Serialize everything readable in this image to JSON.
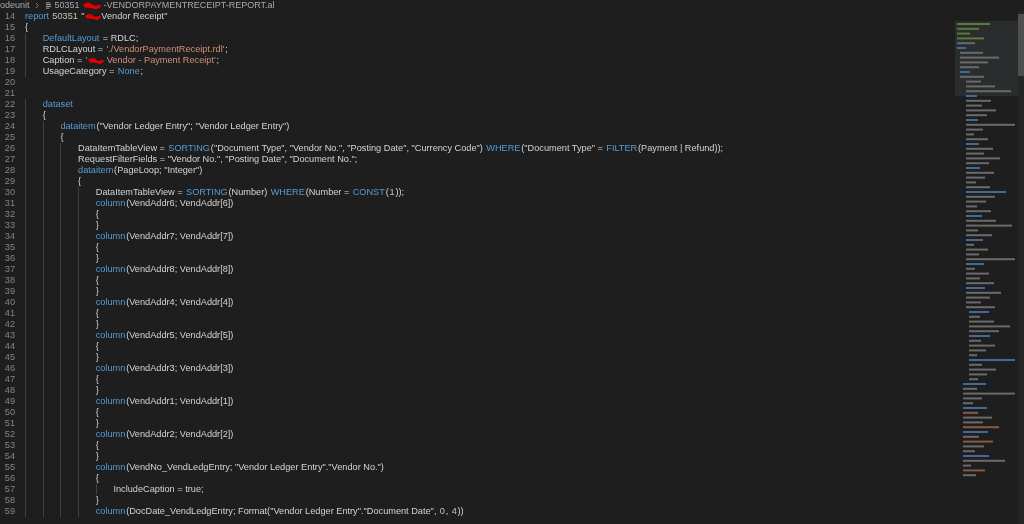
{
  "breadcrumb": {
    "folder": "odeunit",
    "file_prefix": "50351",
    "file_suffix": "-VENDORPAYMENTRECEIPT-REPORT.al"
  },
  "editor": {
    "lines": [
      {
        "number": "14",
        "tokens": [
          {
            "kind": "kw",
            "text": "report"
          },
          {
            "kind": "num",
            "text": " 50351"
          },
          {
            "kind": "plain",
            "text": " \""
          },
          {
            "kind": "redaction"
          },
          {
            "kind": "plain",
            "text": "Vendor Receipt\""
          }
        ]
      },
      {
        "number": "15",
        "tokens": [
          {
            "kind": "plain",
            "text": "{"
          }
        ]
      },
      {
        "number": "16",
        "tokens": [
          {
            "kind": "kw",
            "text": "    DefaultLayout"
          },
          {
            "kind": "plain",
            "text": " = RDLC;"
          }
        ]
      },
      {
        "number": "17",
        "tokens": [
          {
            "kind": "plain",
            "text": "    RDLCLayout = "
          },
          {
            "kind": "str",
            "text": "'./VendorPaymentReceipt.rdl'"
          },
          {
            "kind": "plain",
            "text": ";"
          }
        ]
      },
      {
        "number": "18",
        "tokens": [
          {
            "kind": "plain",
            "text": "    Caption = "
          },
          {
            "kind": "str",
            "text": "'"
          },
          {
            "kind": "redaction"
          },
          {
            "kind": "str",
            "text": " Vendor - Payment Receipt'"
          },
          {
            "kind": "plain",
            "text": ";"
          }
        ]
      },
      {
        "number": "19",
        "tokens": [
          {
            "kind": "plain",
            "text": "    UsageCategory = "
          },
          {
            "kind": "kw",
            "text": "None"
          },
          {
            "kind": "plain",
            "text": ";"
          }
        ]
      },
      {
        "number": "20"
      },
      {
        "number": "21"
      },
      {
        "number": "22",
        "tokens": [
          {
            "kind": "kw",
            "text": "    dataset"
          }
        ]
      },
      {
        "number": "23",
        "tokens": [
          {
            "kind": "plain",
            "text": "    {"
          }
        ]
      },
      {
        "number": "24",
        "tokens": [
          {
            "kind": "kw",
            "text": "        dataitem"
          },
          {
            "kind": "plain",
            "text": "(\"Vendor Ledger Entry\"; \"Vendor Ledger Entry\")"
          }
        ]
      },
      {
        "number": "25",
        "tokens": [
          {
            "kind": "plain",
            "text": "        {"
          }
        ]
      },
      {
        "number": "26",
        "tokens": [
          {
            "kind": "plain",
            "text": "            DataItemTableView = "
          },
          {
            "kind": "kw",
            "text": "SORTING"
          },
          {
            "kind": "plain",
            "text": "(\"Document Type\", \"Vendor No.\", \"Posting Date\", \"Currency Code\") "
          },
          {
            "kind": "kw",
            "text": "WHERE"
          },
          {
            "kind": "plain",
            "text": "(\"Document Type\" = "
          },
          {
            "kind": "kw",
            "text": "FILTER"
          },
          {
            "kind": "plain",
            "text": "(Payment | Refund));"
          }
        ]
      },
      {
        "number": "27",
        "tokens": [
          {
            "kind": "plain",
            "text": "            RequestFilterFields = \"Vendor No.\", \"Posting Date\", \"Document No.\";"
          }
        ]
      },
      {
        "number": "28",
        "tokens": [
          {
            "kind": "kw",
            "text": "            dataitem"
          },
          {
            "kind": "plain",
            "text": "(PageLoop; \"Integer\")"
          }
        ]
      },
      {
        "number": "29",
        "tokens": [
          {
            "kind": "plain",
            "text": "            {"
          }
        ]
      },
      {
        "number": "30",
        "tokens": [
          {
            "kind": "plain",
            "text": "                DataItemTableView = "
          },
          {
            "kind": "kw",
            "text": "SORTING"
          },
          {
            "kind": "plain",
            "text": "(Number) "
          },
          {
            "kind": "kw",
            "text": "WHERE"
          },
          {
            "kind": "plain",
            "text": "(Number = "
          },
          {
            "kind": "kw",
            "text": "CONST"
          },
          {
            "kind": "plain",
            "text": "("
          },
          {
            "kind": "num",
            "text": "1"
          },
          {
            "kind": "plain",
            "text": "));"
          }
        ]
      },
      {
        "number": "31",
        "tokens": [
          {
            "kind": "kw",
            "text": "                column"
          },
          {
            "kind": "plain",
            "text": "(VendAddr6; VendAddr[6])"
          }
        ]
      },
      {
        "number": "32",
        "tokens": [
          {
            "kind": "plain",
            "text": "                {"
          }
        ]
      },
      {
        "number": "33",
        "tokens": [
          {
            "kind": "plain",
            "text": "                }"
          }
        ]
      },
      {
        "number": "34",
        "tokens": [
          {
            "kind": "kw",
            "text": "                column"
          },
          {
            "kind": "plain",
            "text": "(VendAddr7; VendAddr[7])"
          }
        ]
      },
      {
        "number": "35",
        "tokens": [
          {
            "kind": "plain",
            "text": "                {"
          }
        ]
      },
      {
        "number": "36",
        "tokens": [
          {
            "kind": "plain",
            "text": "                }"
          }
        ]
      },
      {
        "number": "37",
        "tokens": [
          {
            "kind": "kw",
            "text": "                column"
          },
          {
            "kind": "plain",
            "text": "(VendAddr8; VendAddr[8])"
          }
        ]
      },
      {
        "number": "38",
        "tokens": [
          {
            "kind": "plain",
            "text": "                {"
          }
        ]
      },
      {
        "number": "39",
        "tokens": [
          {
            "kind": "plain",
            "text": "                }"
          }
        ]
      },
      {
        "number": "40",
        "tokens": [
          {
            "kind": "kw",
            "text": "                column"
          },
          {
            "kind": "plain",
            "text": "(VendAddr4; VendAddr[4])"
          }
        ]
      },
      {
        "number": "41",
        "tokens": [
          {
            "kind": "plain",
            "text": "                {"
          }
        ]
      },
      {
        "number": "42",
        "tokens": [
          {
            "kind": "plain",
            "text": "                }"
          }
        ]
      },
      {
        "number": "43",
        "tokens": [
          {
            "kind": "kw",
            "text": "                column"
          },
          {
            "kind": "plain",
            "text": "(VendAddr5; VendAddr[5])"
          }
        ]
      },
      {
        "number": "44",
        "tokens": [
          {
            "kind": "plain",
            "text": "                {"
          }
        ]
      },
      {
        "number": "45",
        "tokens": [
          {
            "kind": "plain",
            "text": "                }"
          }
        ]
      },
      {
        "number": "46",
        "tokens": [
          {
            "kind": "kw",
            "text": "                column"
          },
          {
            "kind": "plain",
            "text": "(VendAddr3; VendAddr[3])"
          }
        ]
      },
      {
        "number": "47",
        "tokens": [
          {
            "kind": "plain",
            "text": "                {"
          }
        ]
      },
      {
        "number": "48",
        "tokens": [
          {
            "kind": "plain",
            "text": "                }"
          }
        ]
      },
      {
        "number": "49",
        "tokens": [
          {
            "kind": "kw",
            "text": "                column"
          },
          {
            "kind": "plain",
            "text": "(VendAddr1; VendAddr[1])"
          }
        ]
      },
      {
        "number": "50",
        "tokens": [
          {
            "kind": "plain",
            "text": "                {"
          }
        ]
      },
      {
        "number": "51",
        "tokens": [
          {
            "kind": "plain",
            "text": "                }"
          }
        ]
      },
      {
        "number": "52",
        "tokens": [
          {
            "kind": "kw",
            "text": "                column"
          },
          {
            "kind": "plain",
            "text": "(VendAddr2; VendAddr[2])"
          }
        ]
      },
      {
        "number": "53",
        "tokens": [
          {
            "kind": "plain",
            "text": "                {"
          }
        ]
      },
      {
        "number": "54",
        "tokens": [
          {
            "kind": "plain",
            "text": "                }"
          }
        ]
      },
      {
        "number": "55",
        "tokens": [
          {
            "kind": "kw",
            "text": "                column"
          },
          {
            "kind": "plain",
            "text": "(VendNo_VendLedgEntry; \"Vendor Ledger Entry\".\"Vendor No.\")"
          }
        ]
      },
      {
        "number": "56",
        "tokens": [
          {
            "kind": "plain",
            "text": "                {"
          }
        ]
      },
      {
        "number": "57",
        "tokens": [
          {
            "kind": "plain",
            "text": "                    IncludeCaption = true;"
          }
        ]
      },
      {
        "number": "58",
        "tokens": [
          {
            "kind": "plain",
            "text": "                }"
          }
        ]
      },
      {
        "number": "59",
        "tokens": [
          {
            "kind": "kw",
            "text": "                column"
          },
          {
            "kind": "plain",
            "text": "(DocDate_VendLedgEntry; Format(\"Vendor Ledger Entry\".\"Document Date\", "
          },
          {
            "kind": "num",
            "text": "0"
          },
          {
            "kind": "plain",
            "text": ", "
          },
          {
            "kind": "num",
            "text": "4"
          },
          {
            "kind": "plain",
            "text": "))"
          }
        ]
      }
    ]
  }
}
